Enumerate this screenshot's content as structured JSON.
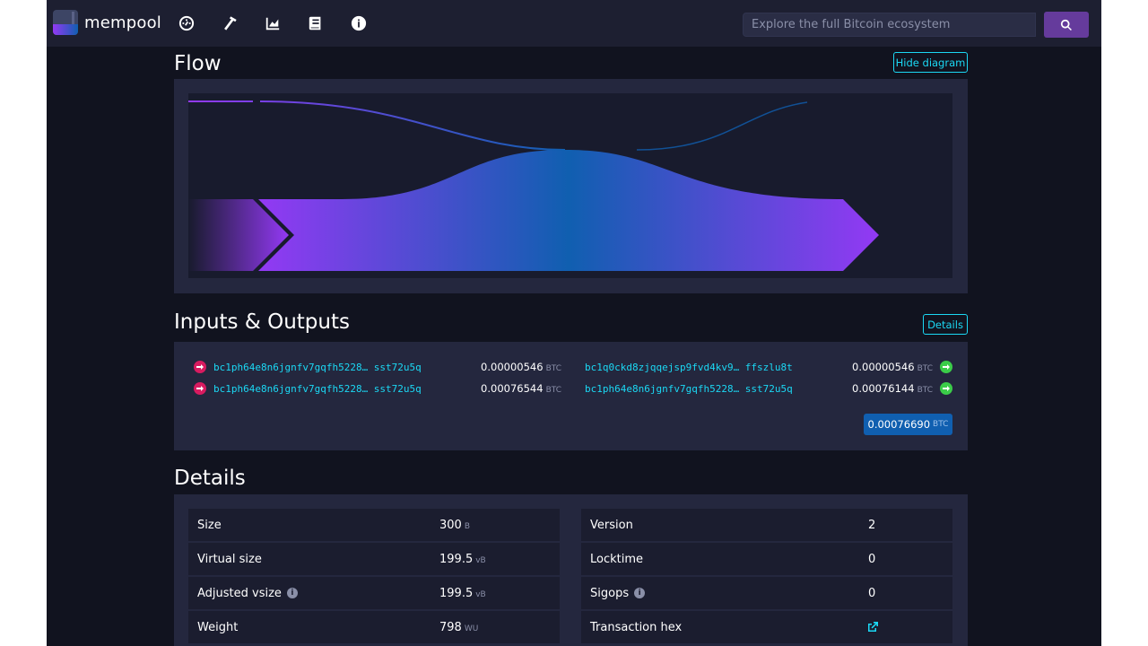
{
  "brand": {
    "name": "mempool"
  },
  "nav": {
    "items": [
      {
        "name": "dashboard-icon"
      },
      {
        "name": "mining-icon"
      },
      {
        "name": "graphs-icon"
      },
      {
        "name": "docs-icon"
      },
      {
        "name": "about-icon"
      }
    ]
  },
  "search": {
    "placeholder": "Explore the full Bitcoin ecosystem",
    "button_icon": "search-icon"
  },
  "flow": {
    "title": "Flow",
    "toggle_label": "Hide diagram"
  },
  "io": {
    "title": "Inputs & Outputs",
    "details_label": "Details",
    "unit": "BTC",
    "inputs": [
      {
        "address": "bc1ph64e8n6jgnfv7gqfh5228… sst72u5q",
        "amount": "0.00000546"
      },
      {
        "address": "bc1ph64e8n6jgnfv7gqfh5228… sst72u5q",
        "amount": "0.00076544"
      }
    ],
    "outputs": [
      {
        "address": "bc1q0ckd8zjqqejsp9fvd4kv9… ffszlu8t",
        "amount": "0.00000546"
      },
      {
        "address": "bc1ph64e8n6jgnfv7gqfh5228… sst72u5q",
        "amount": "0.00076144"
      }
    ],
    "total": "0.00076690"
  },
  "details": {
    "title": "Details",
    "left": [
      {
        "label": "Size",
        "value": "300",
        "unit": "B"
      },
      {
        "label": "Virtual size",
        "value": "199.5",
        "unit": "vB"
      },
      {
        "label": "Adjusted vsize",
        "value": "199.5",
        "unit": "vB"
      },
      {
        "label": "Weight",
        "value": "798",
        "unit": "WU"
      }
    ],
    "right": [
      {
        "label": "Version",
        "value": "2"
      },
      {
        "label": "Locktime",
        "value": "0"
      },
      {
        "label": "Sigops",
        "value": "0"
      },
      {
        "label": "Transaction hex",
        "value_icon": "external-link-icon"
      }
    ]
  },
  "colors": {
    "accent": "#1bd8f4",
    "purple": "#9339f4",
    "blue": "#105fb0",
    "input_red": "#d81b60",
    "output_green": "#3bcc49"
  }
}
